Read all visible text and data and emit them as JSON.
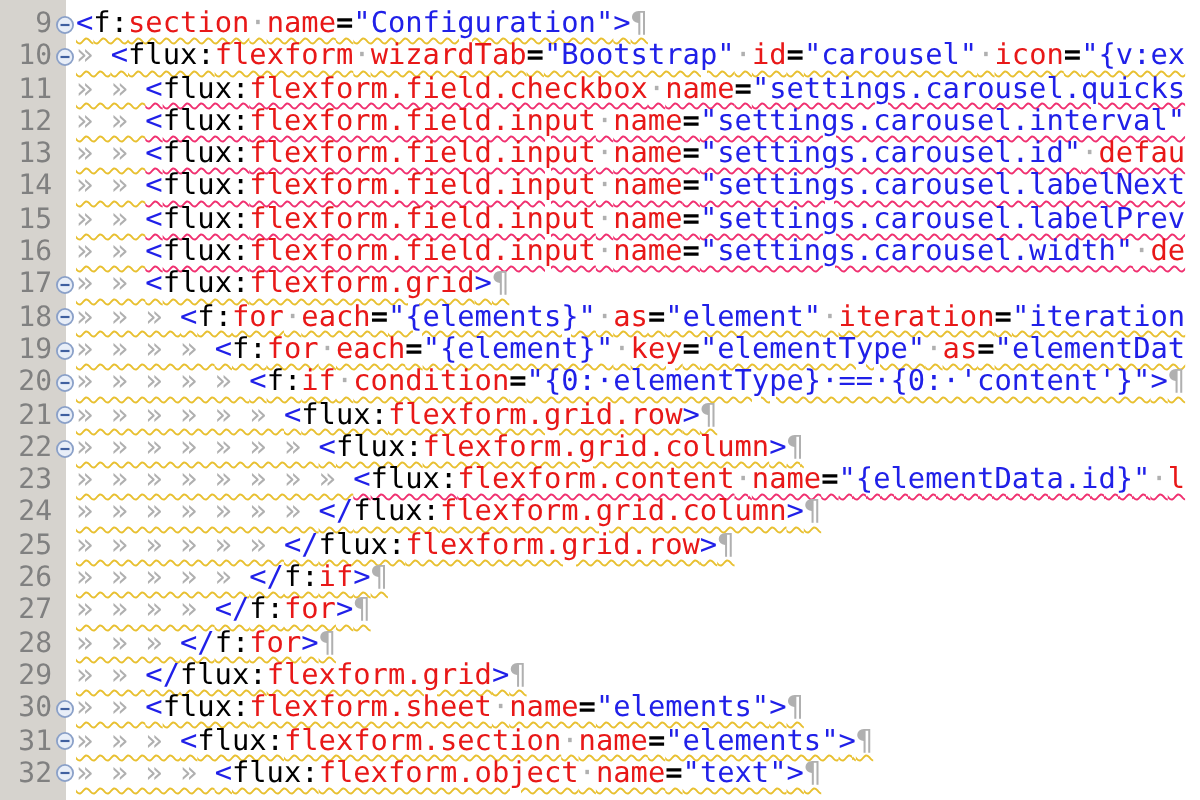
{
  "editor": {
    "lines": [
      {
        "number": "9",
        "foldable": true,
        "error": false,
        "tokens": [
          {
            "kind": "bracket",
            "text": "<"
          },
          {
            "kind": "tag",
            "text": "f:"
          },
          {
            "kind": "name",
            "text": "section"
          },
          {
            "kind": "space",
            "text": "·"
          },
          {
            "kind": "name",
            "text": "name"
          },
          {
            "kind": "eq",
            "text": "="
          },
          {
            "kind": "string",
            "text": "\"Configuration\""
          },
          {
            "kind": "bracket",
            "text": ">"
          },
          {
            "kind": "eol",
            "text": "¶"
          }
        ]
      },
      {
        "number": "10",
        "foldable": true,
        "error": false,
        "indent": "» ",
        "tokens": [
          {
            "kind": "bracket",
            "text": "<"
          },
          {
            "kind": "tag",
            "text": "flux:"
          },
          {
            "kind": "name",
            "text": "flexform"
          },
          {
            "kind": "space",
            "text": "·"
          },
          {
            "kind": "name",
            "text": "wizardTab"
          },
          {
            "kind": "eq",
            "text": "="
          },
          {
            "kind": "string",
            "text": "\"Bootstrap\""
          },
          {
            "kind": "space",
            "text": "·"
          },
          {
            "kind": "name",
            "text": "id"
          },
          {
            "kind": "eq",
            "text": "="
          },
          {
            "kind": "string",
            "text": "\"carousel\""
          },
          {
            "kind": "space",
            "text": "·"
          },
          {
            "kind": "name",
            "text": "icon"
          },
          {
            "kind": "eq",
            "text": "="
          },
          {
            "kind": "string",
            "text": "\"{v:ex"
          }
        ]
      },
      {
        "number": "11",
        "foldable": false,
        "error": true,
        "indent": "» » ",
        "tokens": [
          {
            "kind": "bracket",
            "text": "<"
          },
          {
            "kind": "tag",
            "text": "flux:"
          },
          {
            "kind": "name",
            "text": "flexform.field.checkbox"
          },
          {
            "kind": "space",
            "text": "·"
          },
          {
            "kind": "name",
            "text": "name"
          },
          {
            "kind": "eq",
            "text": "="
          },
          {
            "kind": "string",
            "text": "\"settings.carousel.quicks"
          }
        ]
      },
      {
        "number": "12",
        "foldable": false,
        "error": true,
        "indent": "» » ",
        "tokens": [
          {
            "kind": "bracket",
            "text": "<"
          },
          {
            "kind": "tag",
            "text": "flux:"
          },
          {
            "kind": "name",
            "text": "flexform.field.input"
          },
          {
            "kind": "space",
            "text": "·"
          },
          {
            "kind": "name",
            "text": "name"
          },
          {
            "kind": "eq",
            "text": "="
          },
          {
            "kind": "string",
            "text": "\"settings.carousel.interval\""
          }
        ]
      },
      {
        "number": "13",
        "foldable": false,
        "error": true,
        "indent": "» » ",
        "tokens": [
          {
            "kind": "bracket",
            "text": "<"
          },
          {
            "kind": "tag",
            "text": "flux:"
          },
          {
            "kind": "name",
            "text": "flexform.field.input"
          },
          {
            "kind": "space",
            "text": "·"
          },
          {
            "kind": "name",
            "text": "name"
          },
          {
            "kind": "eq",
            "text": "="
          },
          {
            "kind": "string",
            "text": "\"settings.carousel.id\""
          },
          {
            "kind": "space",
            "text": "·"
          },
          {
            "kind": "name",
            "text": "defau"
          }
        ]
      },
      {
        "number": "14",
        "foldable": false,
        "error": true,
        "indent": "» » ",
        "tokens": [
          {
            "kind": "bracket",
            "text": "<"
          },
          {
            "kind": "tag",
            "text": "flux:"
          },
          {
            "kind": "name",
            "text": "flexform.field.input"
          },
          {
            "kind": "space",
            "text": "·"
          },
          {
            "kind": "name",
            "text": "name"
          },
          {
            "kind": "eq",
            "text": "="
          },
          {
            "kind": "string",
            "text": "\"settings.carousel.labelNext"
          }
        ]
      },
      {
        "number": "15",
        "foldable": false,
        "error": true,
        "indent": "» » ",
        "tokens": [
          {
            "kind": "bracket",
            "text": "<"
          },
          {
            "kind": "tag",
            "text": "flux:"
          },
          {
            "kind": "name",
            "text": "flexform.field.input"
          },
          {
            "kind": "space",
            "text": "·"
          },
          {
            "kind": "name",
            "text": "name"
          },
          {
            "kind": "eq",
            "text": "="
          },
          {
            "kind": "string",
            "text": "\"settings.carousel.labelPrev"
          }
        ]
      },
      {
        "number": "16",
        "foldable": false,
        "error": true,
        "indent": "» » ",
        "tokens": [
          {
            "kind": "bracket",
            "text": "<"
          },
          {
            "kind": "tag",
            "text": "flux:"
          },
          {
            "kind": "name",
            "text": "flexform.field.input"
          },
          {
            "kind": "space",
            "text": "·"
          },
          {
            "kind": "name",
            "text": "name"
          },
          {
            "kind": "eq",
            "text": "="
          },
          {
            "kind": "string",
            "text": "\"settings.carousel.width\""
          },
          {
            "kind": "space",
            "text": "·"
          },
          {
            "kind": "name",
            "text": "de"
          }
        ]
      },
      {
        "number": "17",
        "foldable": true,
        "error": false,
        "indent": "» » ",
        "tokens": [
          {
            "kind": "bracket",
            "text": "<"
          },
          {
            "kind": "tag",
            "text": "flux:"
          },
          {
            "kind": "name",
            "text": "flexform.grid"
          },
          {
            "kind": "bracket",
            "text": ">"
          },
          {
            "kind": "eol",
            "text": "¶"
          }
        ]
      },
      {
        "number": "18",
        "foldable": true,
        "error": false,
        "indent": "» » » ",
        "tokens": [
          {
            "kind": "bracket",
            "text": "<"
          },
          {
            "kind": "tag",
            "text": "f:"
          },
          {
            "kind": "name",
            "text": "for"
          },
          {
            "kind": "space",
            "text": "·"
          },
          {
            "kind": "name",
            "text": "each"
          },
          {
            "kind": "eq",
            "text": "="
          },
          {
            "kind": "string",
            "text": "\"{elements}\""
          },
          {
            "kind": "space",
            "text": "·"
          },
          {
            "kind": "name",
            "text": "as"
          },
          {
            "kind": "eq",
            "text": "="
          },
          {
            "kind": "string",
            "text": "\"element\""
          },
          {
            "kind": "space",
            "text": "·"
          },
          {
            "kind": "name",
            "text": "iteration"
          },
          {
            "kind": "eq",
            "text": "="
          },
          {
            "kind": "string",
            "text": "\"iteration"
          }
        ]
      },
      {
        "number": "19",
        "foldable": true,
        "error": false,
        "indent": "» » » » ",
        "tokens": [
          {
            "kind": "bracket",
            "text": "<"
          },
          {
            "kind": "tag",
            "text": "f:"
          },
          {
            "kind": "name",
            "text": "for"
          },
          {
            "kind": "space",
            "text": "·"
          },
          {
            "kind": "name",
            "text": "each"
          },
          {
            "kind": "eq",
            "text": "="
          },
          {
            "kind": "string",
            "text": "\"{element}\""
          },
          {
            "kind": "space",
            "text": "·"
          },
          {
            "kind": "name",
            "text": "key"
          },
          {
            "kind": "eq",
            "text": "="
          },
          {
            "kind": "string",
            "text": "\"elementType\""
          },
          {
            "kind": "space",
            "text": "·"
          },
          {
            "kind": "name",
            "text": "as"
          },
          {
            "kind": "eq",
            "text": "="
          },
          {
            "kind": "string",
            "text": "\"elementDat"
          }
        ]
      },
      {
        "number": "20",
        "foldable": true,
        "error": false,
        "indent": "» » » » » ",
        "tokens": [
          {
            "kind": "bracket",
            "text": "<"
          },
          {
            "kind": "tag",
            "text": "f:"
          },
          {
            "kind": "name",
            "text": "if"
          },
          {
            "kind": "space",
            "text": "·"
          },
          {
            "kind": "name",
            "text": "condition"
          },
          {
            "kind": "eq",
            "text": "="
          },
          {
            "kind": "string",
            "text": "\"{0:·elementType}·==·{0:·'content'}\""
          },
          {
            "kind": "bracket",
            "text": ">"
          },
          {
            "kind": "eol",
            "text": "¶"
          }
        ]
      },
      {
        "number": "21",
        "foldable": true,
        "error": false,
        "indent": "» » » » » » ",
        "tokens": [
          {
            "kind": "bracket",
            "text": "<"
          },
          {
            "kind": "tag",
            "text": "flux:"
          },
          {
            "kind": "name",
            "text": "flexform.grid.row"
          },
          {
            "kind": "bracket",
            "text": ">"
          },
          {
            "kind": "eol",
            "text": "¶"
          }
        ]
      },
      {
        "number": "22",
        "foldable": true,
        "error": false,
        "indent": "» » » » » » » ",
        "tokens": [
          {
            "kind": "bracket",
            "text": "<"
          },
          {
            "kind": "tag",
            "text": "flux:"
          },
          {
            "kind": "name",
            "text": "flexform.grid.column"
          },
          {
            "kind": "bracket",
            "text": ">"
          },
          {
            "kind": "eol",
            "text": "¶"
          }
        ]
      },
      {
        "number": "23",
        "foldable": false,
        "error": true,
        "indent": "» » » » » » » » ",
        "tokens": [
          {
            "kind": "bracket",
            "text": "<"
          },
          {
            "kind": "tag",
            "text": "flux:"
          },
          {
            "kind": "name",
            "text": "flexform.content"
          },
          {
            "kind": "space",
            "text": "·"
          },
          {
            "kind": "name",
            "text": "name"
          },
          {
            "kind": "eq",
            "text": "="
          },
          {
            "kind": "string",
            "text": "\"{elementData.id}\""
          },
          {
            "kind": "space",
            "text": "·"
          },
          {
            "kind": "name",
            "text": "l"
          }
        ]
      },
      {
        "number": "24",
        "foldable": false,
        "error": false,
        "indent": "» » » » » » » ",
        "tokens": [
          {
            "kind": "bracket",
            "text": "</"
          },
          {
            "kind": "tag",
            "text": "flux:"
          },
          {
            "kind": "name",
            "text": "flexform.grid.column"
          },
          {
            "kind": "bracket",
            "text": ">"
          },
          {
            "kind": "eol",
            "text": "¶"
          }
        ]
      },
      {
        "number": "25",
        "foldable": false,
        "error": false,
        "indent": "» » » » » » ",
        "tokens": [
          {
            "kind": "bracket",
            "text": "</"
          },
          {
            "kind": "tag",
            "text": "flux:"
          },
          {
            "kind": "name",
            "text": "flexform.grid.row"
          },
          {
            "kind": "bracket",
            "text": ">"
          },
          {
            "kind": "eol",
            "text": "¶"
          }
        ]
      },
      {
        "number": "26",
        "foldable": false,
        "error": false,
        "indent": "» » » » » ",
        "tokens": [
          {
            "kind": "bracket",
            "text": "</"
          },
          {
            "kind": "tag",
            "text": "f:"
          },
          {
            "kind": "name",
            "text": "if"
          },
          {
            "kind": "bracket",
            "text": ">"
          },
          {
            "kind": "eol",
            "text": "¶"
          }
        ]
      },
      {
        "number": "27",
        "foldable": false,
        "error": false,
        "indent": "» » » » ",
        "tokens": [
          {
            "kind": "bracket",
            "text": "</"
          },
          {
            "kind": "tag",
            "text": "f:"
          },
          {
            "kind": "name",
            "text": "for"
          },
          {
            "kind": "bracket",
            "text": ">"
          },
          {
            "kind": "eol",
            "text": "¶"
          }
        ]
      },
      {
        "number": "28",
        "foldable": false,
        "error": false,
        "indent": "» » » ",
        "tokens": [
          {
            "kind": "bracket",
            "text": "</"
          },
          {
            "kind": "tag",
            "text": "f:"
          },
          {
            "kind": "name",
            "text": "for"
          },
          {
            "kind": "bracket",
            "text": ">"
          },
          {
            "kind": "eol",
            "text": "¶"
          }
        ]
      },
      {
        "number": "29",
        "foldable": false,
        "error": false,
        "indent": "» » ",
        "tokens": [
          {
            "kind": "bracket",
            "text": "</"
          },
          {
            "kind": "tag",
            "text": "flux:"
          },
          {
            "kind": "name",
            "text": "flexform.grid"
          },
          {
            "kind": "bracket",
            "text": ">"
          },
          {
            "kind": "eol",
            "text": "¶"
          }
        ]
      },
      {
        "number": "30",
        "foldable": true,
        "error": false,
        "indent": "» » ",
        "tokens": [
          {
            "kind": "bracket",
            "text": "<"
          },
          {
            "kind": "tag",
            "text": "flux:"
          },
          {
            "kind": "name",
            "text": "flexform.sheet"
          },
          {
            "kind": "space",
            "text": "·"
          },
          {
            "kind": "name",
            "text": "name"
          },
          {
            "kind": "eq",
            "text": "="
          },
          {
            "kind": "string",
            "text": "\"elements\""
          },
          {
            "kind": "bracket",
            "text": ">"
          },
          {
            "kind": "eol",
            "text": "¶"
          }
        ]
      },
      {
        "number": "31",
        "foldable": true,
        "error": false,
        "indent": "» » » ",
        "tokens": [
          {
            "kind": "bracket",
            "text": "<"
          },
          {
            "kind": "tag",
            "text": "flux:"
          },
          {
            "kind": "name",
            "text": "flexform.section"
          },
          {
            "kind": "space",
            "text": "·"
          },
          {
            "kind": "name",
            "text": "name"
          },
          {
            "kind": "eq",
            "text": "="
          },
          {
            "kind": "string",
            "text": "\"elements\""
          },
          {
            "kind": "bracket",
            "text": ">"
          },
          {
            "kind": "eol",
            "text": "¶"
          }
        ]
      },
      {
        "number": "32",
        "foldable": true,
        "error": false,
        "indent": "» » » » ",
        "tokens": [
          {
            "kind": "bracket",
            "text": "<"
          },
          {
            "kind": "tag",
            "text": "flux:"
          },
          {
            "kind": "name",
            "text": "flexform.object"
          },
          {
            "kind": "space",
            "text": "·"
          },
          {
            "kind": "name",
            "text": "name"
          },
          {
            "kind": "eq",
            "text": "="
          },
          {
            "kind": "string",
            "text": "\"text\""
          },
          {
            "kind": "bracket",
            "text": ">"
          },
          {
            "kind": "eol",
            "text": "¶"
          }
        ]
      }
    ]
  }
}
